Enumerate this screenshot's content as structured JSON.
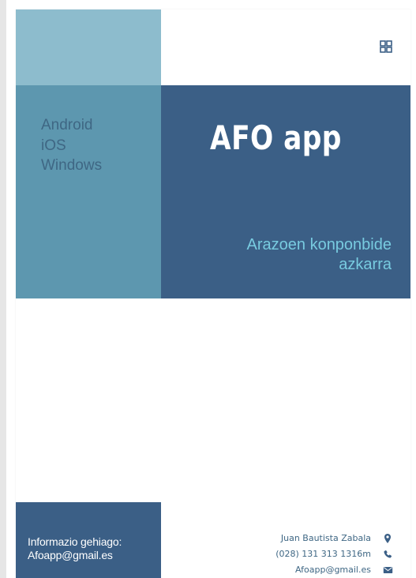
{
  "header": {
    "view_toggle_icon": "grid-view-icon"
  },
  "sidebar": {
    "platforms": [
      "Android",
      "iOS",
      "Windows"
    ]
  },
  "hero": {
    "title": "AFO app",
    "subtitle_lines": [
      "Arazoen konponbide",
      "azkarra"
    ]
  },
  "footer": {
    "more_info_lines": [
      "Informazio gehiago:",
      "Afoapp@gmail.es"
    ],
    "contacts": [
      {
        "label": "Juan Bautista Zabala",
        "icon": "location-pin-icon"
      },
      {
        "label": "(028) 131 313 1316m",
        "icon": "phone-icon"
      },
      {
        "label": "Afoapp@gmail.es",
        "icon": "mail-icon"
      }
    ]
  },
  "colors": {
    "light_blue": "#8dbccd",
    "mid_blue": "#5d97af",
    "dark_blue": "#3b5f86",
    "accent": "#78cbe0"
  }
}
